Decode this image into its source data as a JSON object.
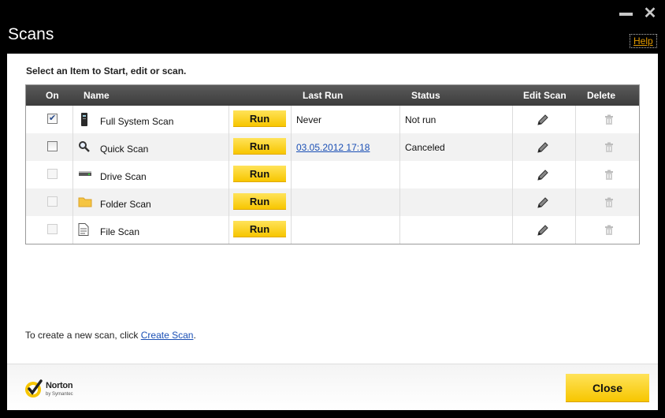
{
  "window": {
    "title": "Scans",
    "help_label": "Help"
  },
  "instruction": "Select an Item to Start, edit or scan.",
  "table": {
    "headers": {
      "on": "On",
      "name": "Name",
      "last_run": "Last Run",
      "status": "Status",
      "edit_scan": "Edit Scan",
      "delete": "Delete"
    },
    "run_label": "Run",
    "rows": [
      {
        "name": "Full System Scan",
        "icon": "computer-icon",
        "checked": true,
        "enabled": true,
        "last_run": "Never",
        "last_run_link": false,
        "status": "Not run"
      },
      {
        "name": "Quick Scan",
        "icon": "magnifier-icon",
        "checked": false,
        "enabled": true,
        "last_run": "03.05.2012 17:18",
        "last_run_link": true,
        "status": "Canceled"
      },
      {
        "name": "Drive Scan",
        "icon": "drive-icon",
        "checked": false,
        "enabled": false,
        "last_run": "",
        "last_run_link": false,
        "status": ""
      },
      {
        "name": "Folder Scan",
        "icon": "folder-icon",
        "checked": false,
        "enabled": false,
        "last_run": "",
        "last_run_link": false,
        "status": ""
      },
      {
        "name": "File Scan",
        "icon": "file-icon",
        "checked": false,
        "enabled": false,
        "last_run": "",
        "last_run_link": false,
        "status": ""
      }
    ]
  },
  "footer": {
    "create_prefix": "To create a new scan, click ",
    "create_link": "Create Scan",
    "create_suffix": "."
  },
  "brand": {
    "name": "Norton",
    "sub": "by Symantec"
  },
  "close_label": "Close",
  "colors": {
    "accent_yellow": "#f7c600",
    "link_blue": "#1a4fb5",
    "help_orange": "#e39a00",
    "header_dark": "#3c3c3c"
  }
}
